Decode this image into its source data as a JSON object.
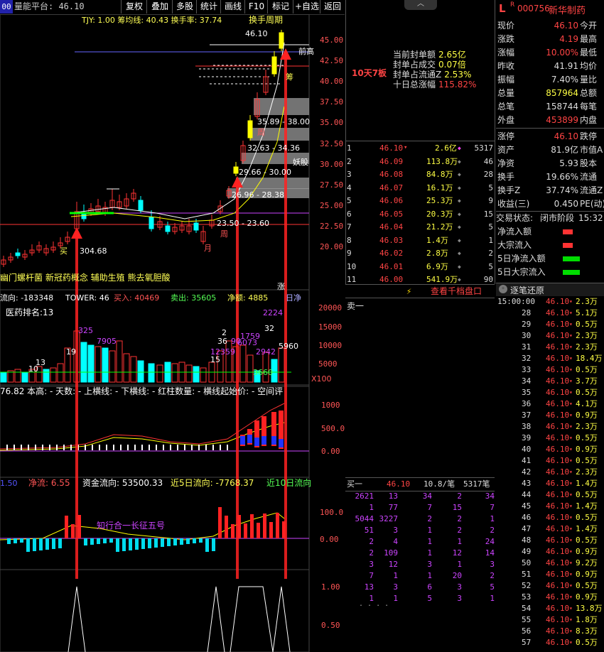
{
  "toolbar": {
    "chip": "00",
    "left_text": "量能平台: 46.10",
    "buttons": [
      "复权",
      "叠加",
      "多股",
      "统计",
      "画线",
      "F10",
      "标记",
      "+自选",
      "返回"
    ]
  },
  "header_info": "TJY: 1.00  筹均线: 40.43  换手率: 37.74",
  "period_label": "换手周期",
  "price_axis": [
    "45.00",
    "42.50",
    "40.00",
    "37.50",
    "35.00",
    "32.50",
    "30.00",
    "27.50",
    "25.00",
    "22.50",
    "20.00"
  ],
  "chart_text": {
    "price_top": "46.10",
    "front_high": "前高",
    "chou": "筹",
    "zone_labels": [
      "35.89 - 38.00",
      "32.63 - 34.36",
      "29.66 - 30.00",
      "26.96 - 28.38",
      "23.50 - 23.60"
    ],
    "zhou": "周",
    "yue": "月",
    "yao": "妖股",
    "left_low": "304.68",
    "left_buy": "买",
    "zhou2": "周",
    "concepts": "幽门螺杆菌  新冠药概念  辅助生殖  熊去氧胆酸",
    "zhang": "涨",
    "day_return": "日净"
  },
  "vol_header": {
    "liuxiang": "流向: -183348",
    "tower": "TOWER: 46",
    "buy": "买入: 40469",
    "sell": "卖出: 35605",
    "net": "净额: 4885"
  },
  "vol_text": {
    "rank": "医药排名:13",
    "n2224": "2224",
    "n32": "32",
    "n325": "325",
    "n7905": "7905",
    "n1759": "1759",
    "n6073": "6073",
    "n2942": "2942",
    "n5960": "5960",
    "n12359": "12359",
    "n3660": "3660",
    "n19": "19",
    "n13": "13",
    "n10": "10",
    "n15": "15",
    "n2": "2",
    "n36": "36",
    "n90": "90",
    "x100": "X100"
  },
  "vol_axis": [
    "20000",
    "15000",
    "10000",
    "5000"
  ],
  "ind_header": "76.82 本高: - 天数: - 上横线: - 下横线: - 红柱数量: - 横线起始价: - 空间评",
  "ind_axis": [
    "1000",
    "500.0",
    "0.00"
  ],
  "money_header": {
    "v1": "1.50",
    "jingliu": "净流: 6.55",
    "zjlx": "资金流向: 53500.33",
    "j5": "近5日流向: -7768.37",
    "j10": "近10日流向"
  },
  "money_axis": [
    "100.0",
    "0.00"
  ],
  "money_label": "知行合一长征五号",
  "bottom_axis": [
    "1.00",
    "0.50"
  ],
  "mid_panel": {
    "title": "10天7板",
    "rows": [
      {
        "label": "当前封单额",
        "value": "2.65亿"
      },
      {
        "label": "封单占成交",
        "value": "0.07倍"
      },
      {
        "label": "封单占流通Z",
        "value": "2.53%"
      },
      {
        "label": "十日总涨幅",
        "value": "115.82%"
      }
    ]
  },
  "stock": {
    "code": "000756",
    "name": "新华制药",
    "prefix": "L",
    "badge": "R"
  },
  "quote_rows": [
    {
      "l": "现价",
      "v": "46.10",
      "r": "今开",
      "vc": "#ff4444"
    },
    {
      "l": "涨跌",
      "v": "4.19",
      "r": "最高",
      "vc": "#ff4444"
    },
    {
      "l": "涨幅",
      "v": "10.00%",
      "r": "最低",
      "vc": "#ff4444"
    },
    {
      "l": "昨收",
      "v": "41.91",
      "r": "均价",
      "vc": "#dddddd"
    },
    {
      "l": "振幅",
      "v": "7.40%",
      "r": "量比",
      "vc": "#dddddd"
    },
    {
      "l": "总量",
      "v": "857964",
      "r": "总额",
      "vc": "#ffff44"
    },
    {
      "l": "总笔",
      "v": "158744",
      "r": "每笔",
      "vc": "#dddddd"
    },
    {
      "l": "外盘",
      "v": "453899",
      "r": "内盘",
      "vc": "#ff4444"
    },
    {
      "l": "涨停",
      "v": "46.10",
      "r": "跌停",
      "vc": "#ff4444"
    },
    {
      "l": "资产",
      "v": "81.9亿",
      "r": "市值A",
      "vc": "#dddddd"
    },
    {
      "l": "净资",
      "v": "5.93",
      "r": "股本",
      "vc": "#dddddd"
    },
    {
      "l": "换手",
      "v": "19.66%",
      "r": "流通",
      "vc": "#dddddd"
    },
    {
      "l": "换手Z",
      "v": "37.74%",
      "r": "流通Z",
      "vc": "#dddddd"
    },
    {
      "l": "收益(三)",
      "v": "0.450",
      "r": "PE(动)",
      "vc": "#dddddd"
    }
  ],
  "trade_status": {
    "label": "交易状态:",
    "value": "闭市阶段",
    "time": "15:32:"
  },
  "flow_rows": [
    {
      "label": "净流入额",
      "color": "#ff3333"
    },
    {
      "label": "大宗流入",
      "color": "#ff3333"
    },
    {
      "label": "5日净流入额",
      "color": "#00dd00"
    },
    {
      "label": "5日大宗流入",
      "color": "#00dd00"
    }
  ],
  "orderbook": [
    {
      "n": "1",
      "p": "46.10",
      "v": "2.6亿",
      "c": "5317"
    },
    {
      "n": "2",
      "p": "46.09",
      "v": "113.8万",
      "c": "46"
    },
    {
      "n": "3",
      "p": "46.08",
      "v": "84.8万",
      "c": "28"
    },
    {
      "n": "4",
      "p": "46.07",
      "v": "16.1万",
      "c": "5"
    },
    {
      "n": "5",
      "p": "46.06",
      "v": "25.3万",
      "c": "9"
    },
    {
      "n": "6",
      "p": "46.05",
      "v": "20.3万",
      "c": "15"
    },
    {
      "n": "7",
      "p": "46.04",
      "v": "21.2万",
      "c": "5"
    },
    {
      "n": "8",
      "p": "46.03",
      "v": "1.4万",
      "c": "1"
    },
    {
      "n": "9",
      "p": "46.02",
      "v": "2.8万",
      "c": "2"
    },
    {
      "n": "10",
      "p": "46.01",
      "v": "6.9万",
      "c": "5"
    },
    {
      "n": "11",
      "p": "46.00",
      "v": "541.9万",
      "c": "90"
    }
  ],
  "depth_link": "查看千档盘口",
  "sell_one": "卖一",
  "buy_one": {
    "label": "买一",
    "price": "46.10",
    "vol": "10.8/笔",
    "count": "5317笔"
  },
  "queue_rows": [
    [
      "2621",
      "13",
      "34",
      "2",
      "34"
    ],
    [
      "1",
      "77",
      "7",
      "15",
      "7"
    ],
    [
      "5044",
      "3227",
      "2",
      "2",
      "1"
    ],
    [
      "51",
      "3",
      "1",
      "2",
      "2"
    ],
    [
      "2",
      "4",
      "1",
      "1",
      "24"
    ],
    [
      "2",
      "109",
      "1",
      "12",
      "14"
    ],
    [
      "3",
      "12",
      "3",
      "1",
      "3"
    ],
    [
      "7",
      "1",
      "1",
      "20",
      "2"
    ],
    [
      "13",
      "3",
      "6",
      "3",
      "5"
    ],
    [
      "1",
      "1",
      "5",
      "3",
      "1"
    ]
  ],
  "queue_more": ". . . .",
  "ticks_title": "逐笔还原",
  "ticks": [
    {
      "t": "15:00:00",
      "p": "46.10",
      "v": "2.3万"
    },
    {
      "t": "28",
      "p": "46.10",
      "v": "5.1万"
    },
    {
      "t": "29",
      "p": "46.10",
      "v": "0.5万"
    },
    {
      "t": "30",
      "p": "46.10",
      "v": "2.3万"
    },
    {
      "t": "31",
      "p": "46.10",
      "v": "2.3万"
    },
    {
      "t": "32",
      "p": "46.10",
      "v": "18.4万"
    },
    {
      "t": "33",
      "p": "46.10",
      "v": "0.5万"
    },
    {
      "t": "34",
      "p": "46.10",
      "v": "3.7万"
    },
    {
      "t": "35",
      "p": "46.10",
      "v": "0.5万"
    },
    {
      "t": "36",
      "p": "46.10",
      "v": "4.1万"
    },
    {
      "t": "37",
      "p": "46.10",
      "v": "0.9万"
    },
    {
      "t": "38",
      "p": "46.10",
      "v": "2.3万"
    },
    {
      "t": "39",
      "p": "46.10",
      "v": "0.5万"
    },
    {
      "t": "40",
      "p": "46.10",
      "v": "0.9万"
    },
    {
      "t": "41",
      "p": "46.10",
      "v": "0.5万"
    },
    {
      "t": "42",
      "p": "46.10",
      "v": "2.3万"
    },
    {
      "t": "43",
      "p": "46.10",
      "v": "1.4万"
    },
    {
      "t": "44",
      "p": "46.10",
      "v": "0.5万"
    },
    {
      "t": "45",
      "p": "46.10",
      "v": "1.4万"
    },
    {
      "t": "46",
      "p": "46.10",
      "v": "0.5万"
    },
    {
      "t": "47",
      "p": "46.10",
      "v": "1.4万"
    },
    {
      "t": "48",
      "p": "46.10",
      "v": "0.5万"
    },
    {
      "t": "49",
      "p": "46.10",
      "v": "0.9万"
    },
    {
      "t": "50",
      "p": "46.10",
      "v": "9.2万"
    },
    {
      "t": "51",
      "p": "46.10",
      "v": "0.9万"
    },
    {
      "t": "52",
      "p": "46.10",
      "v": "0.5万"
    },
    {
      "t": "53",
      "p": "46.10",
      "v": "0.9万"
    },
    {
      "t": "54",
      "p": "46.10",
      "v": "13.8万"
    },
    {
      "t": "55",
      "p": "46.10",
      "v": "1.8万"
    },
    {
      "t": "56",
      "p": "46.10",
      "v": "8.3万"
    },
    {
      "t": "57",
      "p": "46.10",
      "v": "0.5万"
    }
  ]
}
